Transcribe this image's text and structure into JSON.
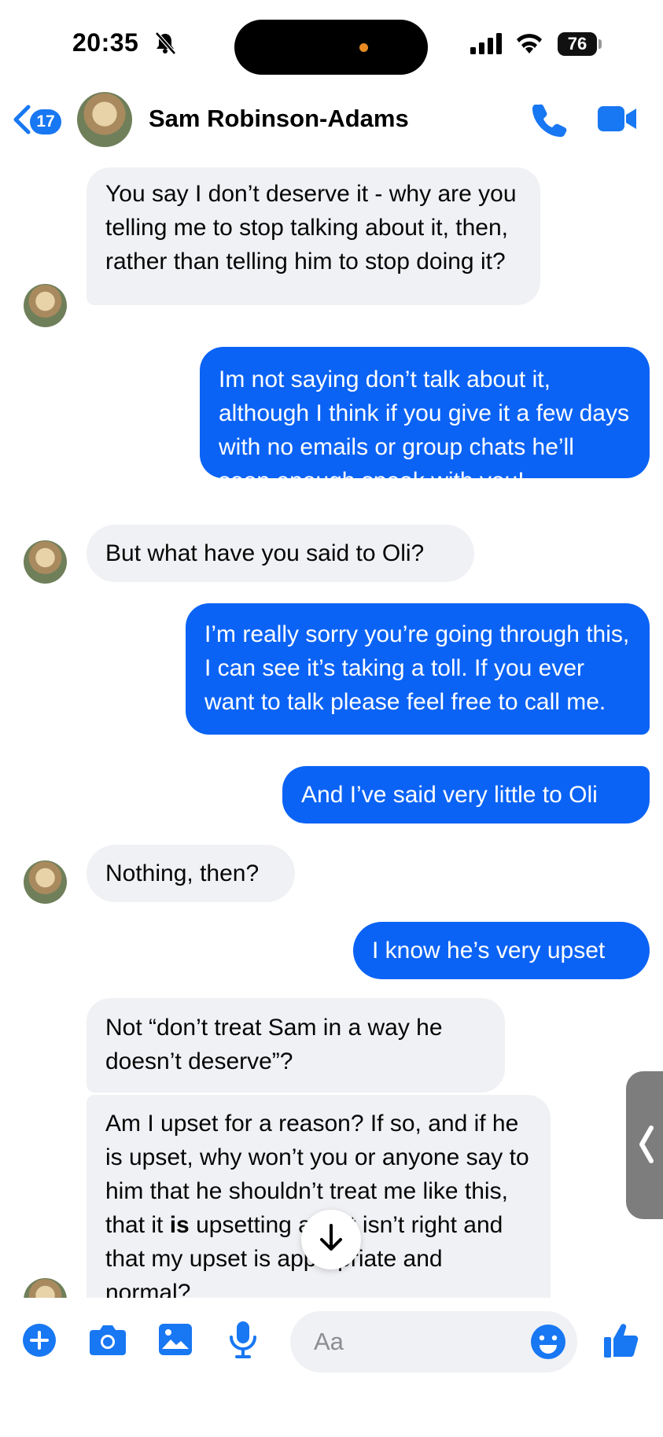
{
  "status_bar": {
    "time": "20:35",
    "battery": "76"
  },
  "header": {
    "back_count": "17",
    "contact_name": "Sam Robinson-Adams"
  },
  "messages": [
    {
      "side": "in",
      "text": "You say I don’t deserve it - why are you telling me to stop talking about it, then, rather than telling him to stop doing it?"
    },
    {
      "side": "out",
      "text": "Im not saying don’t talk about it, although I think if you give it a few days with no emails or group chats he’ll soon enough speak with you!"
    },
    {
      "side": "in",
      "text": "But what have you said to Oli?"
    },
    {
      "side": "out",
      "text": "I’m really sorry you’re going through this, I can see it’s taking a toll. If you ever want to talk please feel free to call me."
    },
    {
      "side": "out",
      "text": "And I’ve said very little to Oli"
    },
    {
      "side": "in",
      "text": "Nothing, then?"
    },
    {
      "side": "out",
      "text": "I know he’s very upset"
    },
    {
      "side": "in",
      "text": "Not “don’t treat Sam in a way he doesn’t deserve”?"
    },
    {
      "side": "in",
      "text_before": "Am I upset for a reason? If so, and if he is upset, why won’t you or anyone say to him that he shouldn’t treat me like this, that it ",
      "text_bold": "is",
      "text_after": " upsetting and it isn’t right and that my upset is appropriate and normal?"
    }
  ],
  "composer": {
    "placeholder": "Aa"
  },
  "icons": {
    "back": "chevron-left-icon",
    "call": "phone-icon",
    "video": "video-camera-icon",
    "add": "plus-icon",
    "camera": "camera-icon",
    "gallery": "photo-icon",
    "mic": "microphone-icon",
    "emoji": "smiley-icon",
    "like": "thumbs-up-icon",
    "scroll_down": "arrow-down-icon"
  },
  "colors": {
    "accent": "#1877f2",
    "outgoing_bubble": "#0b63f5",
    "incoming_bubble": "#f0f1f4"
  }
}
